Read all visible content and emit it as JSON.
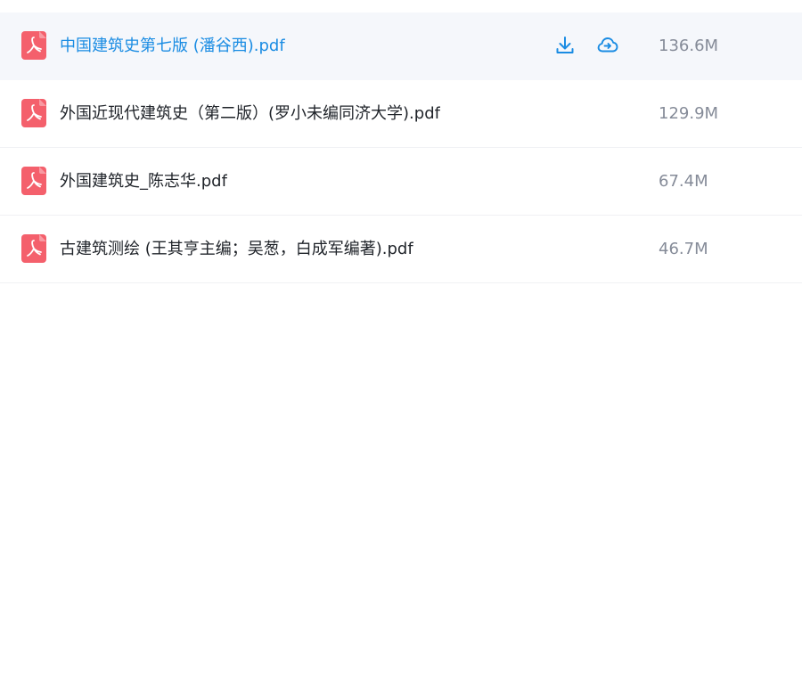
{
  "colors": {
    "accent": "#1a8ce3",
    "pdf_icon": "#f4606c",
    "text": "#1f2329",
    "size_text": "#858b98",
    "hover_bg": "#f5f7fb"
  },
  "files": [
    {
      "name": "中国建筑史第七版 (潘谷西).pdf",
      "size": "136.6M",
      "icon": "pdf-icon",
      "hovered": true
    },
    {
      "name": "外国近现代建筑史（第二版）(罗小未编同济大学).pdf",
      "size": "129.9M",
      "icon": "pdf-icon",
      "hovered": false
    },
    {
      "name": "外国建筑史_陈志华.pdf",
      "size": "67.4M",
      "icon": "pdf-icon",
      "hovered": false
    },
    {
      "name": "古建筑测绘 (王其亨主编；吴葱，白成军编著).pdf",
      "size": "46.7M",
      "icon": "pdf-icon",
      "hovered": false
    }
  ],
  "row_actions": [
    "download-icon",
    "cloud-save-icon"
  ]
}
